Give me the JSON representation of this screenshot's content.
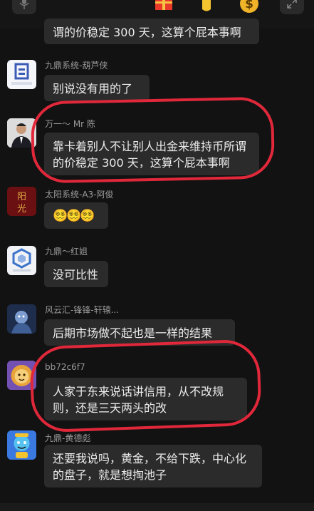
{
  "messages": [
    {
      "id": "m0",
      "sender": "",
      "text": "谓的价稳定 300 天，这算个屁本事啊",
      "avatar": "none"
    },
    {
      "id": "m1",
      "sender": "九鼎系统-葫芦侠",
      "text": "别说没有用的了",
      "avatar": "jiuding-logo",
      "avatar_caption": "九鼎系统"
    },
    {
      "id": "m2",
      "sender": "万一～ Mr 陈",
      "text": "靠卡着别人不让别人出金来维持币所谓的价稳定 300 天，这算个屁本事啊",
      "avatar": "man-photo"
    },
    {
      "id": "m3",
      "sender": "太阳系统-A3-阿俊",
      "text": "😵‍💫😵‍💫😵‍💫",
      "avatar": "calligraphy"
    },
    {
      "id": "m4",
      "sender": "九鼎～红姐",
      "text": "没可比性",
      "avatar": "jiuding-logo",
      "avatar_caption": "九鼎系统"
    },
    {
      "id": "m5",
      "sender": "风云汇-锋锋-轩辕...",
      "text": "后期市场做不起也是一样的结果",
      "avatar": "blue-art"
    },
    {
      "id": "m6",
      "sender": "bb72c6f7",
      "text": "人家于东来说话讲信用，从不改规则，还是三天两头的改",
      "avatar": "lion-cartoon"
    },
    {
      "id": "m7",
      "sender": "九鼎-黄德彪",
      "text": "还要我说吗，黄金，不给下跌，中心化的盘子，就是想掏池子",
      "avatar": "genie-cartoon"
    }
  ],
  "toolbar_icons": [
    "mic-icon",
    "gift-icon",
    "hand-icon",
    "coin-icon",
    "expand-icon"
  ],
  "colors": {
    "background": "#121212",
    "bubble": "#2b2b2b",
    "annotation": "#e0283a"
  }
}
